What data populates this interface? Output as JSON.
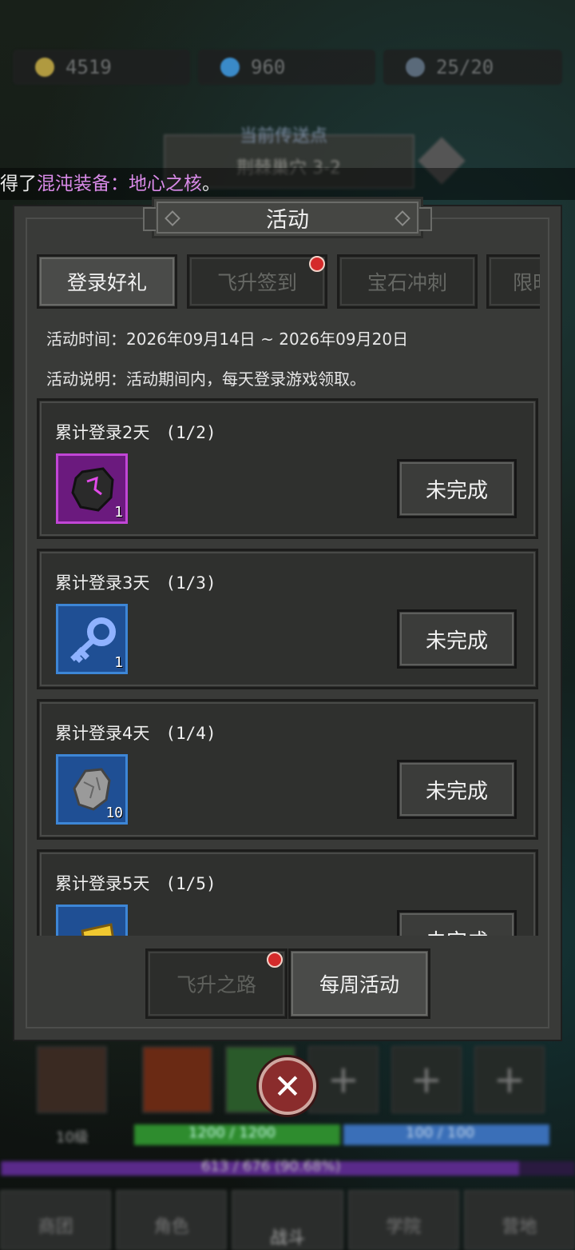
{
  "hud": {
    "gold": "4519",
    "gems": "960",
    "stamina": "25/20",
    "teleport_label": "当前传送点",
    "teleport_location": "荆棘巢穴 3-2",
    "notice_prefix": "得了",
    "notice_item": "混沌装备：地心之核",
    "notice_suffix": "。"
  },
  "dialog": {
    "title": "活动",
    "tabs": [
      {
        "label": "登录好礼",
        "active": true,
        "badge": false
      },
      {
        "label": "飞升签到",
        "active": false,
        "badge": true
      },
      {
        "label": "宝石冲刺",
        "active": false,
        "badge": false
      },
      {
        "label": "限时",
        "active": false,
        "badge": false
      }
    ],
    "activity_time": "活动时间：2026年09月14日 ~ 2026年09月20日",
    "activity_desc": "活动说明：活动期间内，每天登录游戏领取。",
    "rewards": [
      {
        "title": "累计登录2天",
        "progress": "(1/2)",
        "item_icon": "purple-ore-icon",
        "count": "1",
        "status": "未完成"
      },
      {
        "title": "累计登录3天",
        "progress": "(1/3)",
        "item_icon": "blue-key-icon",
        "count": "1",
        "status": "未完成"
      },
      {
        "title": "累计登录4天",
        "progress": "(1/4)",
        "item_icon": "stone-ore-icon",
        "count": "10",
        "status": "未完成"
      },
      {
        "title": "累计登录5天",
        "progress": "(1/5)",
        "item_icon": "gold-ticket-icon",
        "count": "",
        "status": "未完成"
      }
    ],
    "bottom_tabs": [
      {
        "label": "飞升之路",
        "active": false,
        "badge": true
      },
      {
        "label": "每周活动",
        "active": true,
        "badge": false
      }
    ]
  },
  "player": {
    "level": "10级",
    "hp": "1200 / 1200",
    "mp": "100 / 100",
    "xp": "613 / 676 (90.68%)"
  },
  "nav": [
    "商团",
    "角色",
    "战斗",
    "学院",
    "营地"
  ],
  "colors": {
    "accent_purple": "#d98ae8",
    "badge_red": "#d42a2a",
    "close_red": "#8a2c2c"
  }
}
